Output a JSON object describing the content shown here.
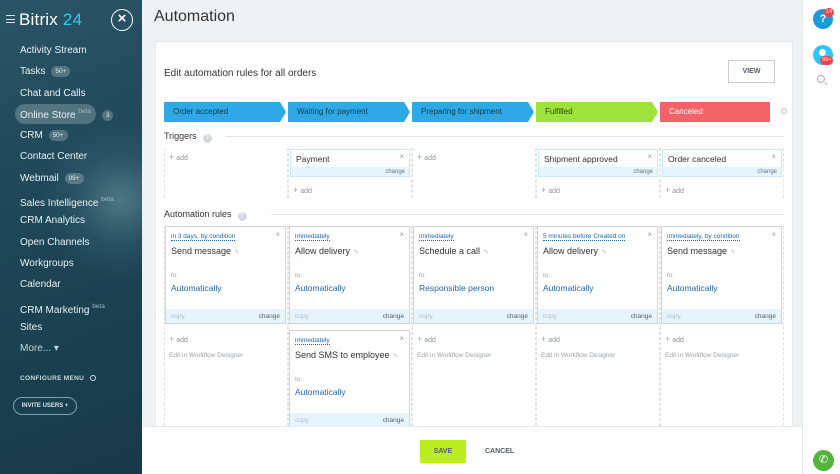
{
  "sidebar": {
    "logo_text": "Bitrix",
    "logo_num": "24",
    "items": [
      {
        "label": "Activity Stream"
      },
      {
        "label": "Tasks",
        "badge": "50+"
      },
      {
        "label": "Chat and Calls"
      },
      {
        "label": "Online Store",
        "sup": "beta",
        "badge": "3"
      },
      {
        "label": "CRM",
        "badge": "50+"
      },
      {
        "label": "Contact Center"
      },
      {
        "label": "Webmail",
        "badge": "99+"
      },
      {
        "label": "Sales Intelligence",
        "sup": "beta"
      },
      {
        "label": "CRM Analytics"
      },
      {
        "label": "Open Channels"
      },
      {
        "label": "Workgroups"
      },
      {
        "label": "Calendar"
      },
      {
        "label": "CRM Marketing",
        "sup": "beta"
      },
      {
        "label": "Sites"
      },
      {
        "label": "More... ▾"
      }
    ],
    "configure_label": "CONFIGURE MENU",
    "invite_label": "INVITE USERS +"
  },
  "page": {
    "title": "Automation",
    "card_title": "Edit automation rules for all orders",
    "view_label": "VIEW"
  },
  "stages": [
    {
      "label": "Order accepted",
      "color": "#2fa8e6"
    },
    {
      "label": "Waiting for payment",
      "color": "#2fa8e6"
    },
    {
      "label": "Preparing for shipment",
      "color": "#2fa8e6"
    },
    {
      "label": "Fulfilled",
      "color": "#9ee33b"
    },
    {
      "label": "Canceled",
      "color": "#f16366"
    }
  ],
  "triggers": {
    "label": "Triggers",
    "help": "?",
    "add_label": "add",
    "close": "×",
    "change_label": "change",
    "cards": [
      {
        "name": "Payment"
      },
      {
        "name": "Shipment approved"
      },
      {
        "name": "Order canceled"
      }
    ]
  },
  "rules": {
    "label": "Automation rules",
    "help": "?",
    "add_label": "add",
    "designer_label": "Edit in Workflow Designer",
    "to_label": "to:",
    "copy_label": "copy",
    "change_label": "change",
    "close": "×",
    "pen": "✎",
    "cards": [
      {
        "when": "in 3 days, by condition",
        "name": "Send message",
        "target": "Automatically"
      },
      {
        "when": "immediately",
        "name": "Allow delivery",
        "target": "Automatically"
      },
      {
        "when": "immediately",
        "name": "Schedule a call",
        "target": "Responsible person"
      },
      {
        "when": "5 minutes before Created on",
        "name": "Allow delivery",
        "target": "Automatically"
      },
      {
        "when": "immediately, by condition",
        "name": "Send message",
        "target": "Automatically"
      },
      {
        "when": "immediately",
        "name": "Send SMS to employee",
        "target": "Automatically"
      }
    ]
  },
  "footer": {
    "save_label": "SAVE",
    "cancel_label": "CANCEL"
  },
  "rail": {
    "help_glyph": "?",
    "help_badge": "14",
    "chat_badge": "99+",
    "phone_glyph": "✆"
  }
}
